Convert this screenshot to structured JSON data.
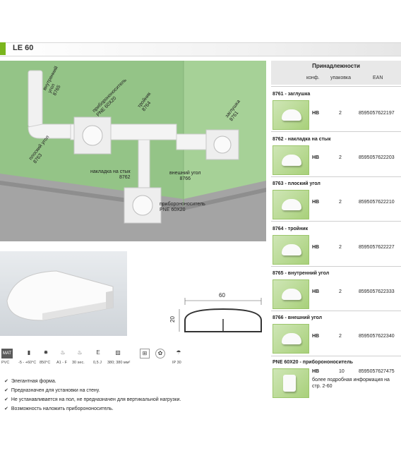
{
  "header": {
    "title": "LE 60"
  },
  "scene_labels": [
    {
      "text": "внутренний\nугол\n8765"
    },
    {
      "text": "приборононоситель\nPNE 60X20"
    },
    {
      "text": "тройник\n8764"
    },
    {
      "text": "заглушка\n8761"
    },
    {
      "text": "плоский угол\n8763"
    },
    {
      "text": "накладка на стык\n8762"
    },
    {
      "text": "внешний угол\n8766"
    },
    {
      "text": "приборононоситель\nPNE 60X20"
    }
  ],
  "dimensions": {
    "width": "60",
    "height": "20"
  },
  "icons": [
    {
      "name": "material-icon",
      "glyph": "MAT",
      "label": "PVC"
    },
    {
      "name": "temperature-icon",
      "glyph": "▮",
      "label": "-5 - +60°C"
    },
    {
      "name": "fire-test-icon",
      "glyph": "✹",
      "label": "850°C"
    },
    {
      "name": "flame-class-icon",
      "glyph": "♨",
      "label": "A1 - F"
    },
    {
      "name": "flame-time-icon",
      "glyph": "♨",
      "label": "30 sec."
    },
    {
      "name": "impact-icon",
      "glyph": "E",
      "label": "0,5 J"
    },
    {
      "name": "cross-section-icon",
      "glyph": "▨",
      "label": "380; 380 мм²"
    },
    {
      "name": "socket-icon",
      "glyph": "⊞",
      "label": ""
    },
    {
      "name": "halogen-free-icon",
      "glyph": "✿",
      "label": ""
    },
    {
      "name": "ip-icon",
      "glyph": "☂",
      "label": "IP 30"
    }
  ],
  "features": [
    "Элегантная форма.",
    "Предназначен для установки на стену.",
    "Не устанавливается на пол, не предназначен для вертикальной нагрузки.",
    "Возможность наложить приборононоситель."
  ],
  "accessories": {
    "title": "Принадлежности",
    "columns": [
      "конф.",
      "упаковка",
      "EAN"
    ],
    "items": [
      {
        "title": "8761 - заглушка",
        "conf": "НВ",
        "pack": "2",
        "ean": "8595057622197"
      },
      {
        "title": "8762 - накладка на стык",
        "conf": "НВ",
        "pack": "2",
        "ean": "8595057622203"
      },
      {
        "title": "8763 - плоский угол",
        "conf": "НВ",
        "pack": "2",
        "ean": "8595057622210"
      },
      {
        "title": "8764 - тройник",
        "conf": "НВ",
        "pack": "2",
        "ean": "8595057622227"
      },
      {
        "title": "8765 - внутренний угол",
        "conf": "НВ",
        "pack": "2",
        "ean": "8595057622333"
      },
      {
        "title": "8766 - внешний угол",
        "conf": "НВ",
        "pack": "2",
        "ean": "8595057622340"
      },
      {
        "title": "PNE 60X20 - приборононоситель",
        "conf": "НВ",
        "pack": "10",
        "ean": "8595057627475",
        "note": "более подробная информация на стр. 2-60"
      }
    ]
  }
}
